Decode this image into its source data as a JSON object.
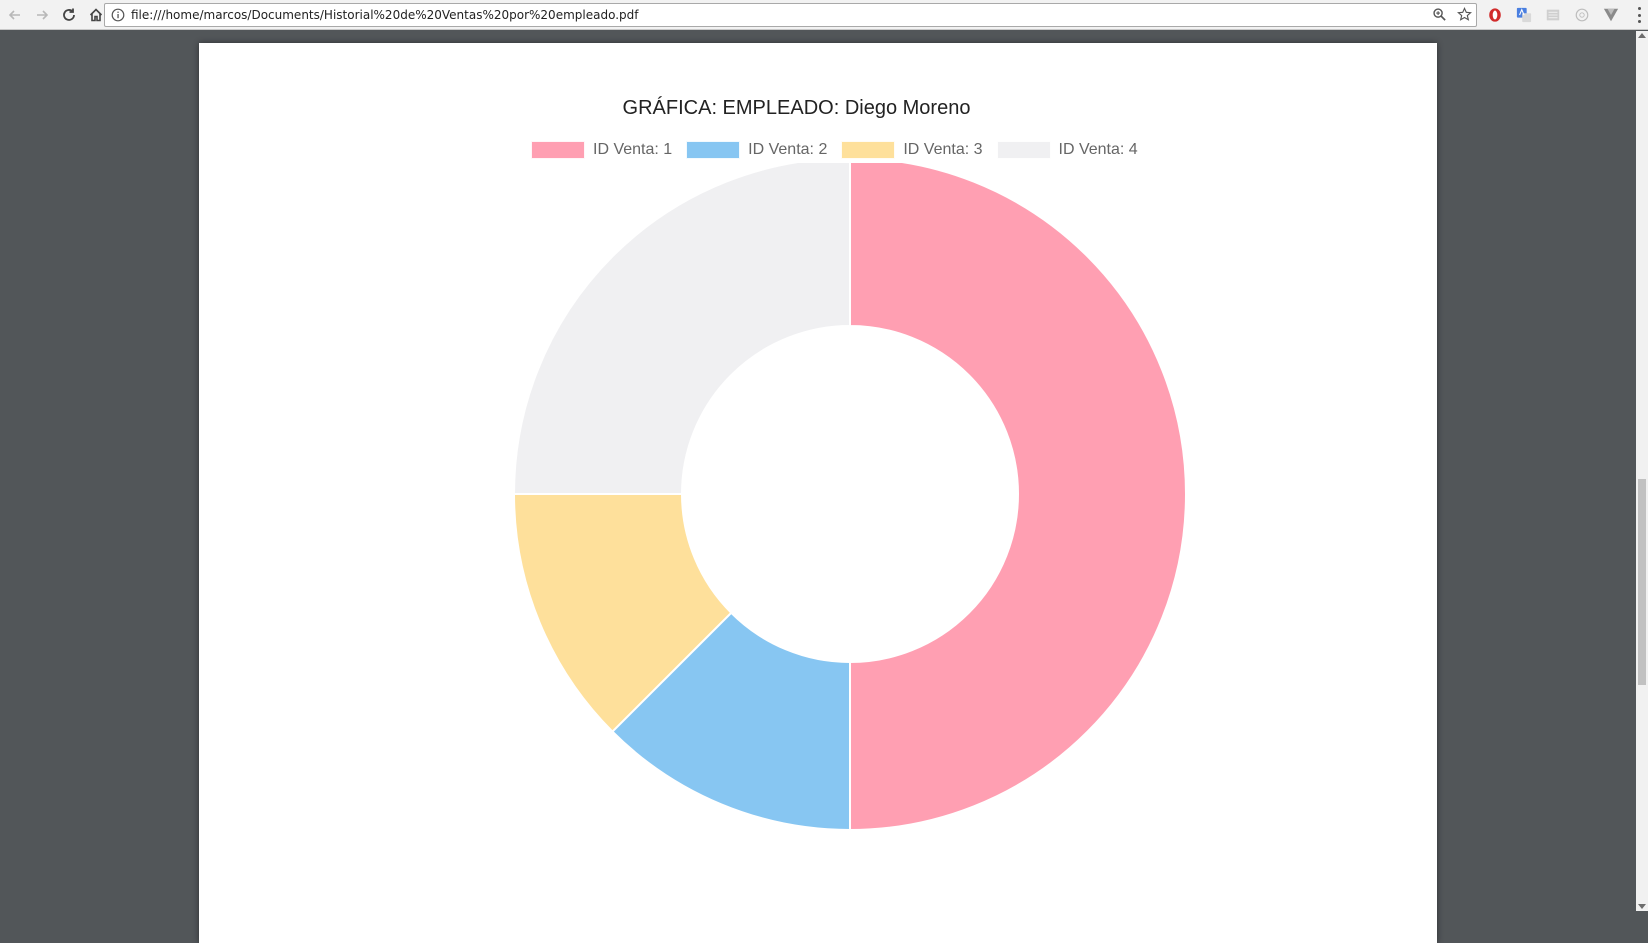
{
  "browser": {
    "url": "file:///home/marcos/Documents/Historial%20de%20Ventas%20por%20empleado.pdf",
    "icons": {
      "back": "arrow-left-icon",
      "forward": "arrow-right-icon",
      "reload": "reload-icon",
      "home": "home-icon",
      "info": "info-icon",
      "zoom": "zoom-icon",
      "bookmark": "star-icon",
      "menu": "menu-dots-icon"
    }
  },
  "chart_data": {
    "type": "doughnut",
    "title": "GRÁFICA: EMPLEADO: Diego Moreno",
    "legend_position": "top",
    "series": [
      {
        "name": "ID Venta: 1",
        "value": 50,
        "color": "#ff9fb2"
      },
      {
        "name": "ID Venta: 2",
        "value": 12.5,
        "color": "#87c6f2"
      },
      {
        "name": "ID Venta: 3",
        "value": 12.5,
        "color": "#fee09b"
      },
      {
        "name": "ID Venta: 4",
        "value": 25,
        "color": "#f0f0f2"
      }
    ]
  }
}
